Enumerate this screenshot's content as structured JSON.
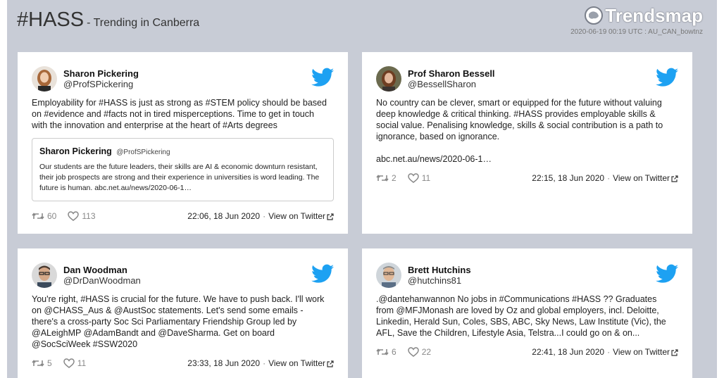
{
  "header": {
    "hashtag": "#HASS",
    "subtitle": "- Trending in Canberra",
    "brand": "Trendsmap",
    "stamp": "2020-06-19 00:19 UTC : AU_CAN_bowtnz"
  },
  "tweets": [
    {
      "name": "Sharon Pickering",
      "handle": "@ProfSPickering",
      "text": "Employability for #HASS is just as strong as #STEM policy should be based on #evidence and #facts not in tired misperceptions. Time to get in touch with the innovation and enterprise at the heart of #Arts degrees",
      "quote": {
        "name": "Sharon Pickering",
        "handle": "@ProfSPickering",
        "text": "Our students are the future leaders, their skills are AI & economic downturn resistant, their job prospects are strong and their experience in universities is word leading. The future is human. abc.net.au/news/2020-06-1…"
      },
      "retweets": "60",
      "likes": "113",
      "time": "22:06, 18 Jun 2020",
      "view_label": "View on Twitter"
    },
    {
      "name": "Prof Sharon Bessell",
      "handle": "@BessellSharon",
      "text": "No country can be clever, smart or equipped for the future without valuing deep knowledge & critical thinking. #HASS provides employable skills & social value. Penalising knowledge, skills & social contribution is a path to ignorance, based on ignorance.",
      "link": "abc.net.au/news/2020-06-1…",
      "retweets": "2",
      "likes": "11",
      "time": "22:15, 18 Jun 2020",
      "view_label": "View on Twitter"
    },
    {
      "name": "Dan Woodman",
      "handle": "@DrDanWoodman",
      "text": "You're right, #HASS is crucial for the future. We have to push back. I'll work on @CHASS_Aus & @AustSoc statements. Let's send some emails - there's a cross-party Soc Sci Parliamentary Friendship Group led by @ALeighMP @AdamBandt and @DaveSharma. Get on board @SocSciWeek #SSW2020",
      "retweets": "5",
      "likes": "11",
      "time": "23:33, 18 Jun 2020",
      "view_label": "View on Twitter"
    },
    {
      "name": "Brett Hutchins",
      "handle": "@hutchins81",
      "text": ".@dantehanwannon No jobs in #Communications #HASS ?? Graduates from @MFJMonash are loved by Oz and global employers, incl. Deloitte, Linkedin, Herald Sun, Coles, SBS, ABC, Sky News, Law Institute (Vic), the AFL, Save the Children, Lifestyle Asia, Telstra...I could go on & on...",
      "retweets": "6",
      "likes": "22",
      "time": "22:41, 18 Jun 2020",
      "view_label": "View on Twitter"
    }
  ],
  "colors": {
    "twitter": "#1da1f2",
    "panel": "#c8ccd6"
  },
  "icons": [
    "twitter-bird-icon",
    "retweet-icon",
    "heart-icon",
    "external-link-icon",
    "trendsmap-logo-icon"
  ]
}
